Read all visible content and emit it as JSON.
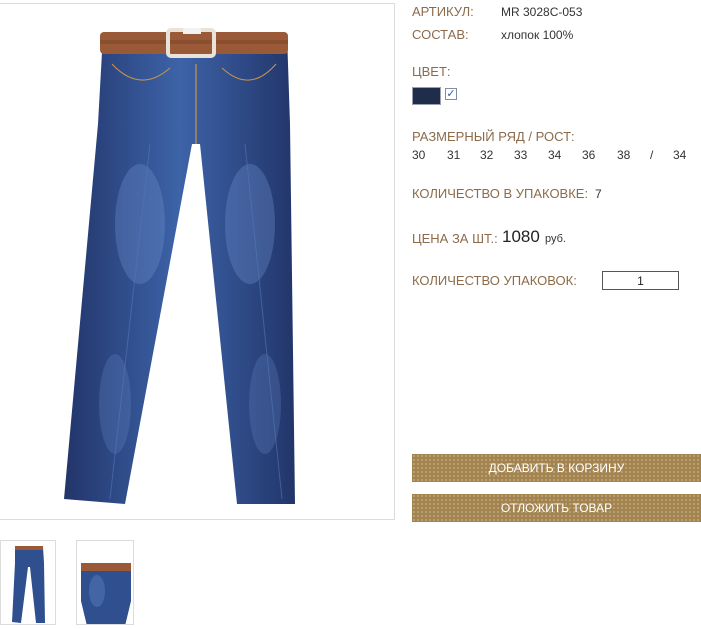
{
  "product": {
    "article_label": "АРТИКУЛ:",
    "article_value": "MR 3028C-053",
    "composition_label": "СОСТАВ:",
    "composition_value": "хлопок 100%",
    "color_label": "ЦВЕТ:",
    "color_swatch": "#1f2d4a",
    "color_checked": true,
    "sizes_label": "РАЗМЕРНЫЙ РЯД / РОСТ:",
    "sizes": [
      "30",
      "31",
      "32",
      "33",
      "34",
      "36",
      "38",
      "/",
      "34"
    ],
    "pack_qty_label": "КОЛИЧЕСТВО В УПАКОВКЕ:",
    "pack_qty_value": "7",
    "price_label": "ЦЕНА ЗА ШТ.:",
    "price_value": "1080",
    "price_currency": "руб.",
    "packs_label": "КОЛИЧЕСТВО УПАКОВОК:",
    "packs_value": "1"
  },
  "buttons": {
    "add_to_cart": "ДОБАВИТЬ В КОРЗИНУ",
    "postpone": "ОТЛОЖИТЬ ТОВАР"
  },
  "colors": {
    "label_brown": "#8b6b4a",
    "button_gold": "#a4844e",
    "denim": "#2c4a86"
  },
  "images": {
    "main": "jeans-front-photo",
    "thumbnails": [
      "jeans-full-thumb",
      "jeans-waist-thumb"
    ]
  }
}
